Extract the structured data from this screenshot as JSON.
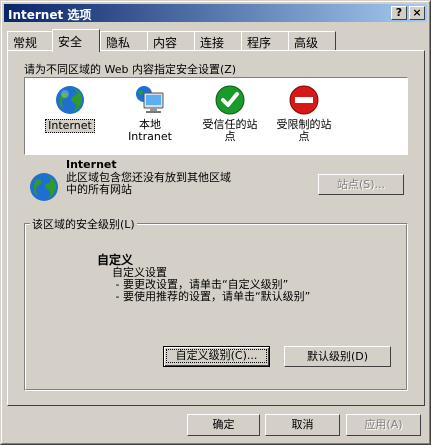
{
  "window": {
    "title": "Internet 选项",
    "help_button": "?",
    "close_button": "×"
  },
  "tabs": [
    {
      "label": "常规"
    },
    {
      "label": "安全",
      "active": true
    },
    {
      "label": "隐私"
    },
    {
      "label": "内容"
    },
    {
      "label": "连接"
    },
    {
      "label": "程序"
    },
    {
      "label": "高级"
    }
  ],
  "security": {
    "zone_prompt": "请为不同区域的 Web 内容指定安全设置(Z)",
    "zones": [
      {
        "label": "Internet",
        "icon": "globe-icon",
        "selected": true
      },
      {
        "label_line1": "本地",
        "label_line2": "Intranet",
        "icon": "local-intranet-icon"
      },
      {
        "label_line1": "受信任的站",
        "label_line2": "点",
        "icon": "trusted-sites-icon"
      },
      {
        "label_line1": "受限制的站",
        "label_line2": "点",
        "icon": "restricted-sites-icon"
      }
    ],
    "selected_zone_title": "Internet",
    "selected_zone_desc_line1": "此区域包含您还没有放到其他区域",
    "selected_zone_desc_line2": "中的所有网站",
    "sites_button": "站点(S)...",
    "level_group_label": "该区域的安全级别(L)",
    "level_name": "自定义",
    "level_desc": "自定义设置\n - 要更改设置，请单击“自定义级别”\n - 要使用推荐的设置，请单击“默认级别”",
    "custom_level_button": "自定义级别(C)...",
    "default_level_button": "默认级别(D)"
  },
  "footer": {
    "ok_button": "确定",
    "cancel_button": "取消",
    "apply_button": "应用(A)"
  },
  "colors": {
    "titlebar_start": "#0a246a",
    "titlebar_end": "#a6caf0",
    "face": "#d4d0c8",
    "trusted_green": "#1a9a2a",
    "restricted_red": "#d81818"
  }
}
